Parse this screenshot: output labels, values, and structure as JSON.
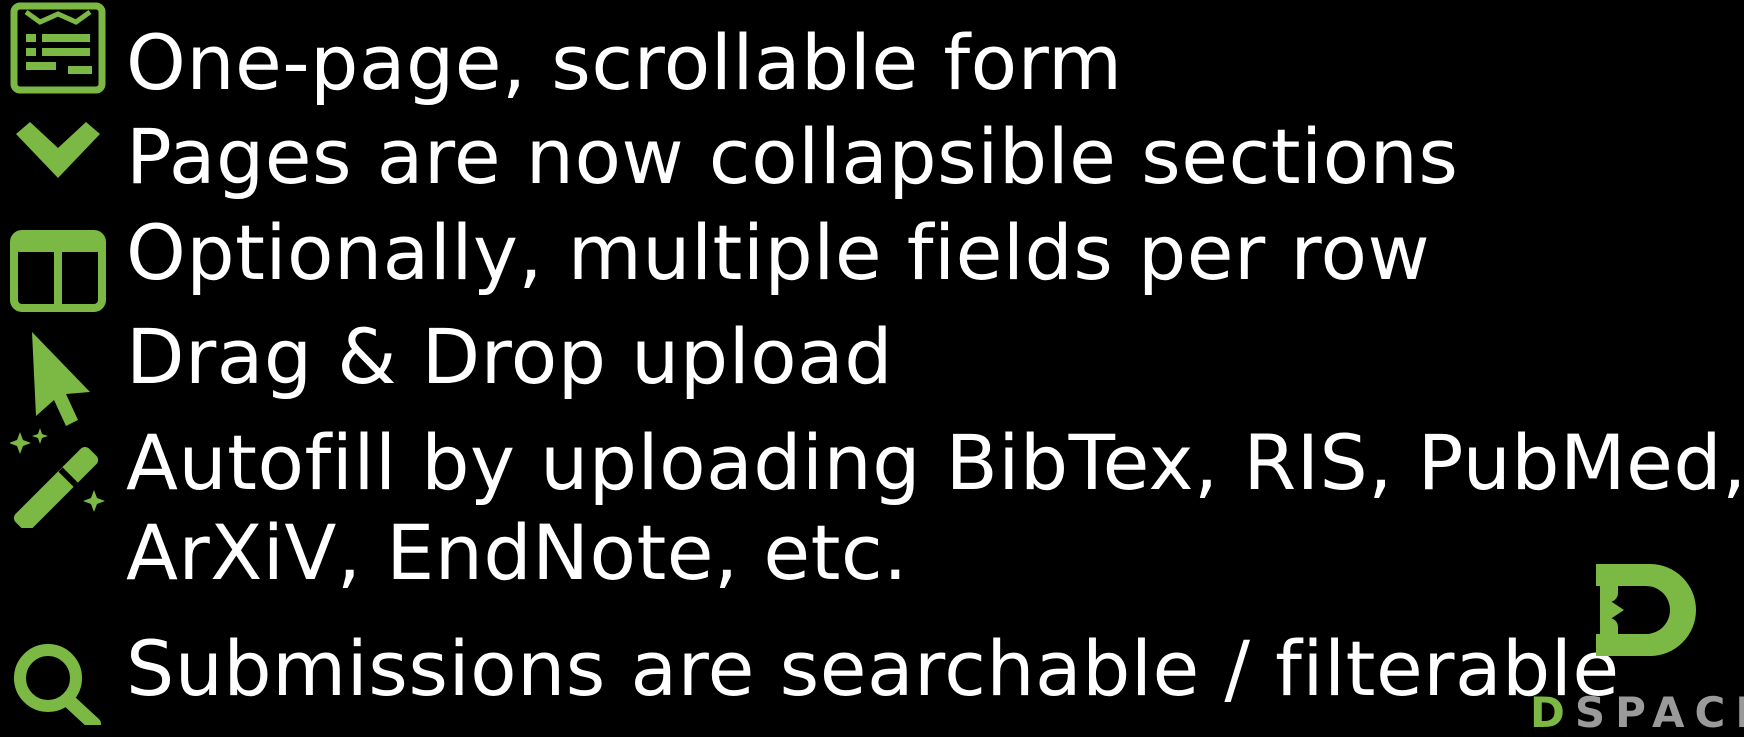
{
  "colors": {
    "accent": "#7cb944",
    "text": "#ffffff",
    "background": "#000000"
  },
  "features": [
    {
      "icon": "form-icon",
      "text": "One-page, scrollable form"
    },
    {
      "icon": "chevron-down-icon",
      "text": "Pages are now collapsible sections"
    },
    {
      "icon": "columns-icon",
      "text": "Optionally, multiple fields per row"
    },
    {
      "icon": "cursor-icon",
      "text": "Drag & Drop upload"
    },
    {
      "icon": "magic-wand-icon",
      "text": "Autofill by uploading BibTex, RIS, PubMed,",
      "text_line2": "ArXiV, EndNote, etc."
    },
    {
      "icon": "search-icon",
      "text": "Submissions are searchable / filterable"
    }
  ],
  "logo": {
    "first_letter": "D",
    "rest": "SPACE"
  }
}
